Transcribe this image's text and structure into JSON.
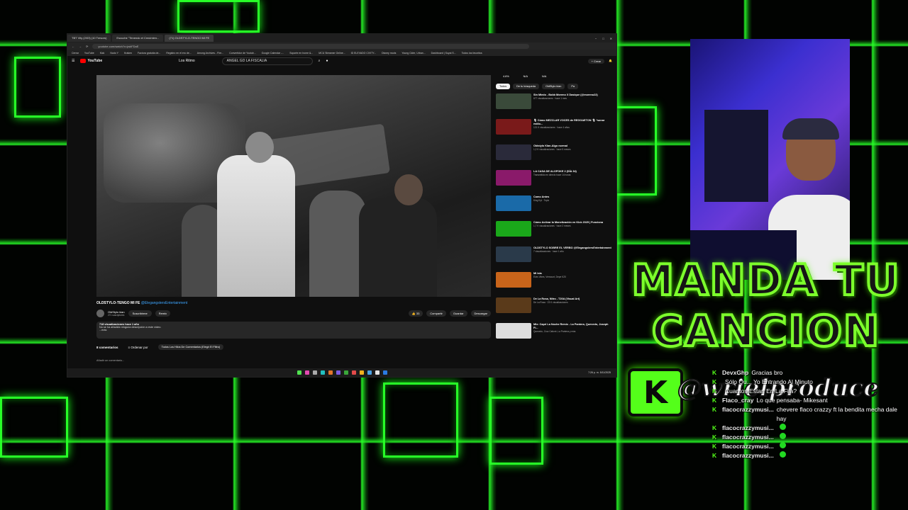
{
  "browser": {
    "tabs": [
      "TBT Vity (2/03) (10 Tresors)",
      "Escuche \"Tenendo el Crecimien...",
      "(71) OLDSTYLO-TENGO MI FE"
    ],
    "url": "youtube.com/watch?v=jwkFDaE",
    "bookmarks": [
      "Cerrar",
      "YouTube",
      "Kick",
      "Nodo Y",
      "Kraken",
      "Factura gratuita de...",
      "Registro en el ero de...",
      "Among Archives - Fire...",
      "Convertidor de Youtub...",
      "Google Calendar -...",
      "Soporte en home &...",
      "MCU Streamer Online...",
      "ID ELEVADO CIVITY...",
      "Disney mods",
      "Young Cider, Urban...",
      "Dashboard | Suyai S...",
      "Todos los favoritos"
    ]
  },
  "youtube": {
    "logo": "YouTube",
    "channel_chip": "Los Ritmo",
    "search_value": "ANGEL GD LA FISCALIA",
    "create_label": "+ Crear",
    "video_title": "OLDSTYLO-TENGO MI FE",
    "video_title_link": "@ElegangstersEntertainment",
    "channel_name": "OldStylo klan",
    "subscribers": "271 suscriptores",
    "subscribe_label": "Suscribirme",
    "remix_label": "Remix",
    "like_count": "33",
    "share_label": "Compartir",
    "save_label": "Guardar",
    "download_label": "Descargar",
    "desc_views": "718 visualizaciones hace 1 año",
    "desc_text": "No se ha añadido ninguna descripción a este vídeo.",
    "desc_more": "...más",
    "comments_count": "8 comentarios",
    "sort_label": "Ordenar por",
    "filter_chip": "Todos Los Hilos De Comentarios (Elegir El Filtro)",
    "add_comment": "Añadir un comentario...",
    "stats": [
      "4.6%",
      "N/A",
      "N/A"
    ],
    "sidebar_chips": [
      "Todos",
      "De tu búsqueda",
      "OldStylo klan",
      "Pa"
    ],
    "recommendations": [
      {
        "title": "Sin Miedo - Bobb Moreno X Dasique (@moreno22)",
        "meta": "677 visualizaciones · hace 1 mes",
        "color": "#3a4a3a"
      },
      {
        "title": "🎙 Cómo MEZCLAR VOCES de REGGAETON 🎙 *sonar estilo...",
        "meta": "121 K visualizaciones · hace 4 años",
        "color": "#7a1a1a"
      },
      {
        "title": "Oldstylo Klan-Algo normal",
        "meta": "1,2 K visualizaciones · hace 5 meses",
        "color": "#2a2a3a"
      },
      {
        "title": "LA CASA DE ALOFOKE 2 (DÍA 34)",
        "meta": "Transmitido en directo hace 14 horas",
        "color": "#8a1a6a"
      },
      {
        "title": "Como Antes",
        "meta": "King Kyt · Topic",
        "color": "#1a6aa8"
      },
      {
        "title": "Cómo Activar la Monetización en Kick 2025 | Funciona",
        "meta": "1,7 K visualizaciones · hace 2 meses",
        "color": "#1aa81a"
      },
      {
        "title": "OLDSTYLO SOBRE EL VERBO @ElegangstersEntertainment",
        "meta": "7 visualizaciones · hace 1 año",
        "color": "#2a3a4a"
      },
      {
        "title": "Mi isla",
        "meta": "Elvis Vibes, Vemount, Depe K20",
        "color": "#c8641a"
      },
      {
        "title": "De La Rosa, Nitro - T20A (Visual Art)",
        "meta": "De La Rosa · 23 K visualizaciones",
        "color": "#5a3a1a"
      },
      {
        "title": "Mix: Capri La Noche Remix - La Pantera, Quevedo, Joseph Fi...",
        "meta": "Quevedo, Cruz Cafuné, La Pantera y más",
        "color": "#dddddd"
      }
    ]
  },
  "taskbar": {
    "time": "7:26 p. m.",
    "date": "5/11/2025"
  },
  "overlay": {
    "headline_line1": "MANDA TU",
    "headline_line2": "CANCION",
    "kick_letter": "K",
    "handle": "@wrielproduce"
  },
  "chat": [
    {
      "user": "DevxGhp",
      "text": "Gracias bro"
    },
    {
      "user": "",
      "text": "Sólo Qu... Yo Entrando Al Minuto"
    },
    {
      "user": "",
      "text": "Cuantos Estan En La Fila?"
    },
    {
      "user": "Flaco_cray",
      "text": "Lo que pensaba- Mikesant"
    },
    {
      "user": "flacocrazzymusi...",
      "text": "chevere flaco crazzy ft la bendita mecha dale hay"
    },
    {
      "user": "flacocrazzymusi...",
      "text": ""
    },
    {
      "user": "flacocrazzymusi...",
      "text": ""
    },
    {
      "user": "flacocrazzymusi...",
      "text": ""
    },
    {
      "user": "flacocrazzymusi...",
      "text": ""
    }
  ],
  "colors": {
    "accent": "#54ff1a",
    "yt_red": "#ff0000",
    "link": "#3ea6ff"
  }
}
